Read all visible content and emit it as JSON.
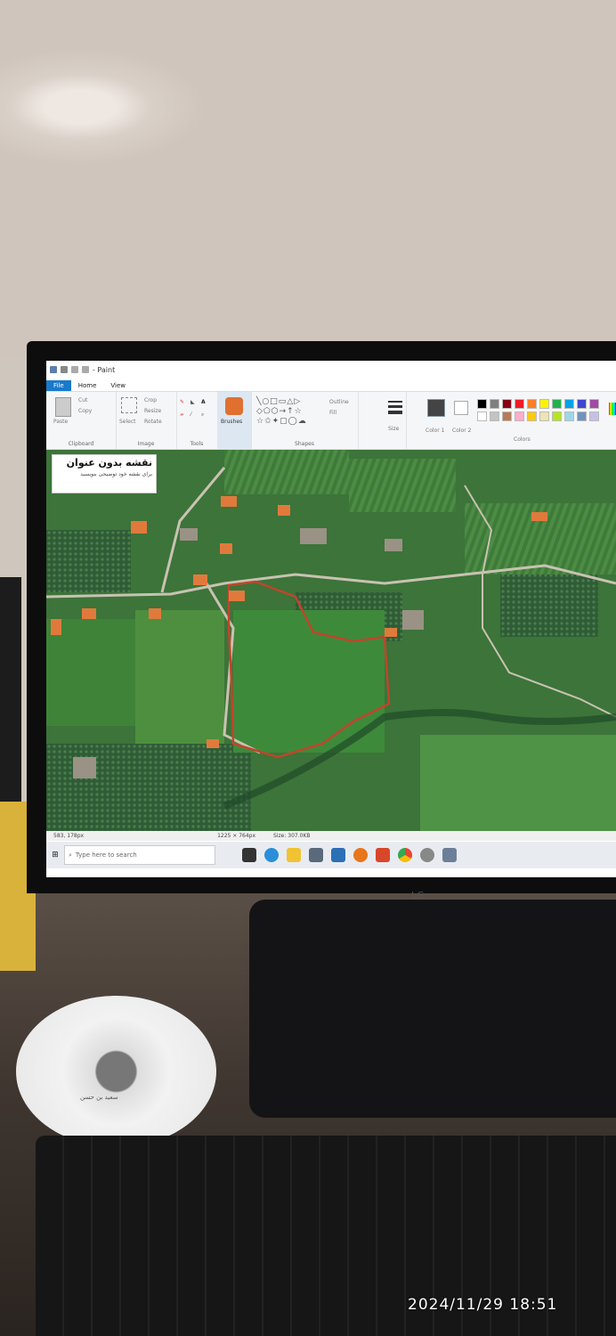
{
  "photo": {
    "timestamp": "2024/11/29 18:51",
    "monitor_brand": "LG"
  },
  "paint": {
    "title": "- Paint",
    "tabs": [
      "File",
      "Home",
      "View"
    ],
    "ribbon": {
      "clipboard": {
        "label": "Clipboard",
        "paste": "Paste",
        "cut": "Cut",
        "copy": "Copy"
      },
      "image": {
        "label": "Image",
        "select": "Select",
        "crop": "Crop",
        "resize": "Resize",
        "rotate": "Rotate"
      },
      "tools": {
        "label": "Tools"
      },
      "brushes": {
        "label": "Brushes"
      },
      "shapes": {
        "label": "Shapes",
        "outline": "Outline",
        "fill": "Fill"
      },
      "size": {
        "label": "Size"
      },
      "color1": "Color 1",
      "color2": "Color 2",
      "colors": {
        "label": "Colors",
        "edit": "Edit colors"
      }
    },
    "palette": [
      "#000000",
      "#7f7f7f",
      "#880015",
      "#ed1c24",
      "#ff7f27",
      "#fff200",
      "#22b14c",
      "#00a2e8",
      "#3f48cc",
      "#a349a4",
      "#ffffff",
      "#c3c3c3",
      "#b97a57",
      "#ffaec9",
      "#ffc90e",
      "#efe4b0",
      "#b5e61d",
      "#99d9ea",
      "#7092be",
      "#c8bfe7"
    ],
    "legend": {
      "title": "نقشه بدون عنوان",
      "subtitle": "برای نقشه خود توضیحی بنویسید"
    },
    "status": {
      "cursor": "583, 178px",
      "dimensions": "1225 × 764px",
      "size": "Size: 307.0KB"
    }
  },
  "taskbar": {
    "search_placeholder": "Type here to search",
    "start_icon": "windows-logo-icon"
  },
  "cd_label": "سعید بن حسن"
}
